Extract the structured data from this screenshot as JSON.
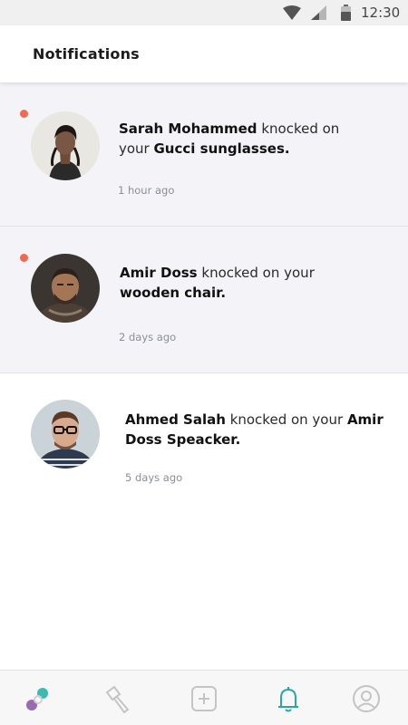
{
  "status_bar": {
    "time": "12:30"
  },
  "header": {
    "title": "Notifications"
  },
  "notifications": [
    {
      "user": "Sarah Mohammed",
      "action": " knocked on your ",
      "item": "Gucci sunglasses.",
      "time_ago": "1 hour ago",
      "unread": true
    },
    {
      "user": "Amir Doss",
      "action": " knocked on your ",
      "item": "wooden chair.",
      "time_ago": "2 days ago",
      "unread": true
    },
    {
      "user": "Ahmed Salah",
      "action": " knocked on your ",
      "item": "Amir Doss Speacker.",
      "time_ago": "5 days ago",
      "unread": false
    }
  ],
  "bottom_nav": {
    "items": [
      "discover-icon",
      "flashlight-icon",
      "add-icon",
      "bell-icon",
      "profile-icon"
    ],
    "active": "bell-icon"
  },
  "colors": {
    "unread_dot": "#ef6a4f",
    "unread_bg": "#f4f3f7",
    "accent": "#2aa6a6",
    "nav_icon": "#c4c4c4"
  }
}
